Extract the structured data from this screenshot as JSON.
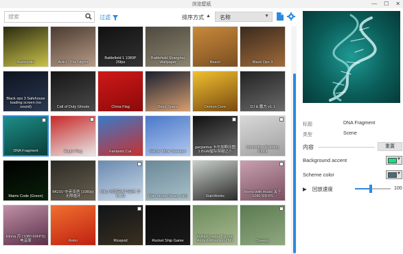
{
  "window": {
    "title": "浏览壁纸",
    "min": "—",
    "max": "☐",
    "close": "✕"
  },
  "toolbar": {
    "search_placeholder": "搜索",
    "filter_label": "过滤",
    "sort_label": "排序方式",
    "sort_direction": "▲",
    "sort_value": "名称",
    "sort_caret": "▼"
  },
  "wallpapers": [
    {
      "label": "Audiophile",
      "color1": "#2a2a10",
      "color2": "#c9c24a",
      "badge": false
    },
    {
      "label": "Aviici - The Nights",
      "color1": "#4a3a30",
      "color2": "#b79c88",
      "badge": false
    },
    {
      "label": "Battlefield 1 1080P 25fps",
      "color1": "#111111",
      "color2": "#333333",
      "badge": false
    },
    {
      "label": "Battlefield Shanghai Wallpaper",
      "color1": "#4e4a3e",
      "color2": "#8c8470",
      "badge": false
    },
    {
      "label": "Beach",
      "color1": "#c9893a",
      "color2": "#7a4f22",
      "badge": false
    },
    {
      "label": "Black Ops 3",
      "color1": "#3a2a1e",
      "color2": "#a06a3a",
      "badge": false
    },
    {
      "label": "Black ops 3 Safehouse loading screen (no sound)",
      "color1": "#0e1420",
      "color2": "#2a3850",
      "badge": false
    },
    {
      "label": "Call of Duty Ghosts",
      "color1": "#151515",
      "color2": "#4a4a4a",
      "badge": false
    },
    {
      "label": "China Flag",
      "color1": "#d01818",
      "color2": "#8c0a0a",
      "badge": false
    },
    {
      "label": "Deep Space",
      "color1": "#1a2030",
      "color2": "#d8a070",
      "badge": false
    },
    {
      "label": "Demon Core",
      "color1": "#f0c030",
      "color2": "#7a4a10",
      "badge": false
    },
    {
      "label": "DJ & 魔方 v1.1",
      "color1": "#222222",
      "color2": "#6a6a6a",
      "badge": false
    },
    {
      "label": "DNA Fragment",
      "color1": "#1d8d86",
      "color2": "#083e3b",
      "badge": true
    },
    {
      "label": "Eagle Flag",
      "color1": "#c82828",
      "color2": "#e8e8e8",
      "badge": true
    },
    {
      "label": "Fantastic Car",
      "color1": "#3a7ac8",
      "color2": "#c83030",
      "badge": false
    },
    {
      "label": "Game: Mine Sweeper",
      "color1": "#4a78c8",
      "color2": "#b0c8f0",
      "badge": false
    },
    {
      "label": "gargantua 卡尔加斯冈图 1.BGM星际穿越之小",
      "color1": "#101010",
      "color2": "#707070",
      "badge": true
    },
    {
      "label": "Interactive Rotating Clock",
      "color1": "#d8d8d8",
      "color2": "#a0a0a0",
      "badge": true
    },
    {
      "label": "Matrix Code (Green)",
      "color1": "#000000",
      "color2": "#0a200a",
      "badge": false
    },
    {
      "label": "MGSV 中英双语 (1080p) 无限循环",
      "color1": "#2a2a24",
      "color2": "#6a6050",
      "badge": false
    },
    {
      "label": "Miku 可设定天气音乐 手 v1.22",
      "color1": "#6a8ab0",
      "color2": "#c8d8e8",
      "badge": true
    },
    {
      "label": "Rain drops (heavy rain)",
      "color1": "#6a8898",
      "color2": "#a8c0c8",
      "badge": false
    },
    {
      "label": "RainWorks",
      "color1": "#c8d0c8",
      "color2": "#2a2a2a",
      "badge": false
    },
    {
      "label": "Remu with music 关于 1080 60FPS",
      "color1": "#c8a0b0",
      "color2": "#7a5060",
      "badge": true
    },
    {
      "label": "Rinna 月 (1080 60FPS) 电音版",
      "color1": "#c090a8",
      "color2": "#5a3048",
      "badge": false
    },
    {
      "label": "Retro",
      "color1": "#f07030",
      "color2": "#c02010",
      "badge": false
    },
    {
      "label": "Ricepod",
      "color1": "#101418",
      "color2": "#3a3020",
      "badge": true
    },
    {
      "label": "Rocket Ship Game",
      "color1": "#0a0a0a",
      "color2": "#1a1a1a",
      "badge": false
    },
    {
      "label": "RollerCoaster Tycoon Added Attractions Mix",
      "color1": "#6a8a5a",
      "color2": "#a8b890",
      "badge": false
    },
    {
      "label": "Sneeps",
      "color1": "#5a7a50",
      "color2": "#90a880",
      "badge": true
    }
  ],
  "details": {
    "title_key": "标题",
    "title_val": "DNA Fragment",
    "type_key": "类型",
    "type_val": "Scene",
    "section": "内容",
    "reset": "重置",
    "bg_accent_label": "Background accent",
    "bg_accent_color": "#18e080",
    "scheme_label": "Scheme color",
    "scheme_color": "#4a6a80",
    "speed_label": "回放速度",
    "speed_value": "100",
    "speed_fraction": 0.45
  }
}
